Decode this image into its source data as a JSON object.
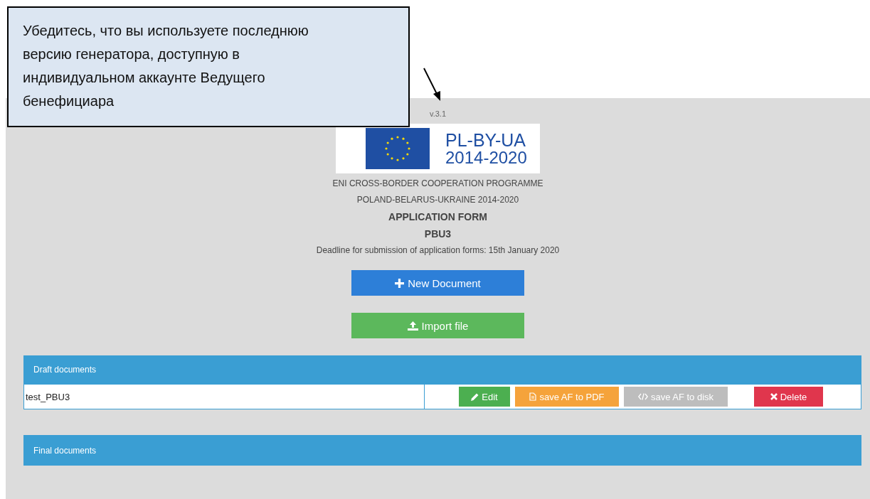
{
  "callout": {
    "text": "Убедитесь, что вы используете последнюю версию генератора, доступную в индивидуальном аккаунте Ведущего бенефициара"
  },
  "version": "v.3.1",
  "logo": {
    "line1": "PL-BY-UA",
    "line2": "2014-2020"
  },
  "headings": [
    {
      "text": "ENI CROSS-BORDER COOPERATION PROGRAMME",
      "kind": "plain"
    },
    {
      "text": "POLAND-BELARUS-UKRAINE 2014-2020",
      "kind": "plain"
    },
    {
      "text": "APPLICATION FORM",
      "kind": "bold"
    },
    {
      "text": "PBU3",
      "kind": "bold"
    },
    {
      "text": "Deadline for submission of application forms: 15th January 2020",
      "kind": "plain"
    }
  ],
  "main_buttons": [
    {
      "label": "New Document",
      "kind": "new"
    },
    {
      "label": "Import file",
      "kind": "import"
    }
  ],
  "draft_panel": {
    "title": "Draft documents",
    "rows": [
      {
        "name": "test_PBU3",
        "actions": [
          {
            "label": "Edit",
            "kind": "edit"
          },
          {
            "label": "save AF to PDF",
            "kind": "pdf"
          },
          {
            "label": "save AF to disk",
            "kind": "disk"
          },
          {
            "label": "Delete",
            "kind": "delete"
          }
        ]
      }
    ]
  },
  "final_panel": {
    "title": "Final documents"
  }
}
